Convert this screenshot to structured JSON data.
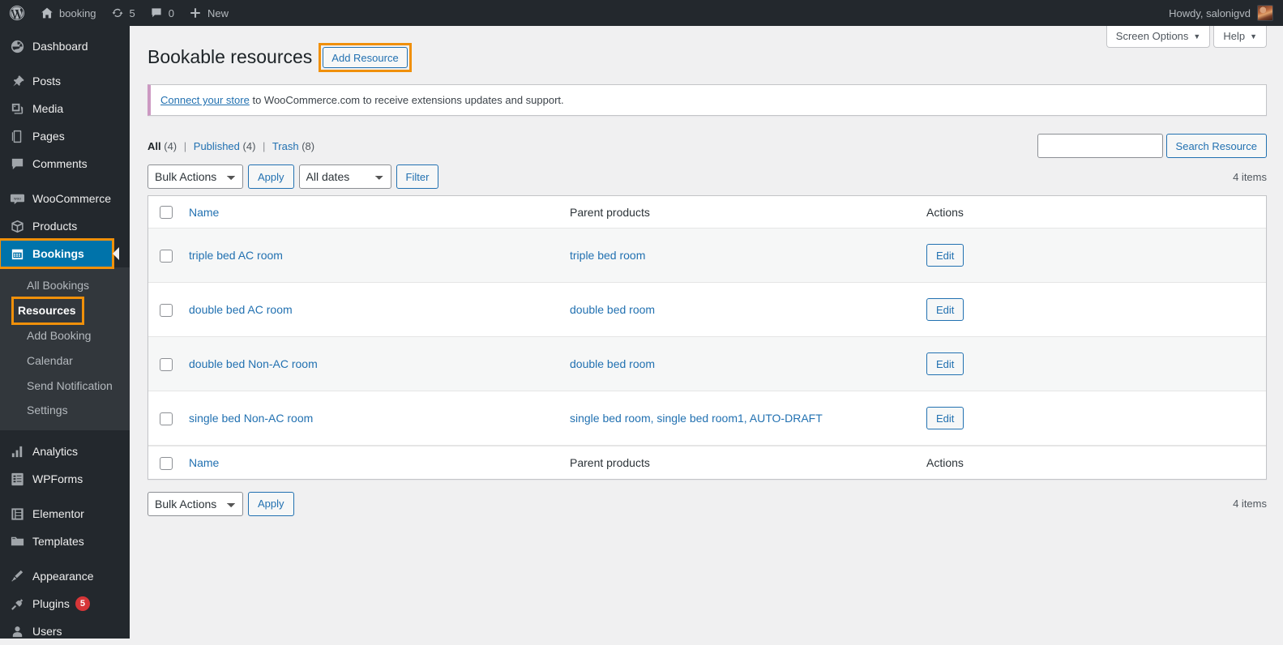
{
  "adminbar": {
    "logo_icon": "wordpress-logo-icon",
    "site_name": "booking",
    "home_icon": "home-icon",
    "updates_icon": "updates-icon",
    "updates_count": "5",
    "comments_icon": "comments-icon",
    "comments_count": "0",
    "new_icon": "plus-icon",
    "new_label": "New",
    "howdy": "Howdy, salonigvd",
    "avatar_name": "user-avatar"
  },
  "sidebar": {
    "items": [
      {
        "label": "Dashboard",
        "icon": "dashboard-icon",
        "name": "dashboard"
      },
      {
        "label": "Posts",
        "icon": "posts-pin-icon",
        "name": "posts"
      },
      {
        "label": "Media",
        "icon": "media-icon",
        "name": "media"
      },
      {
        "label": "Pages",
        "icon": "pages-icon",
        "name": "pages"
      },
      {
        "label": "Comments",
        "icon": "comments-icon",
        "name": "comments"
      },
      {
        "label": "WooCommerce",
        "icon": "woocommerce-icon",
        "name": "woocommerce"
      },
      {
        "label": "Products",
        "icon": "products-box-icon",
        "name": "products"
      },
      {
        "label": "Bookings",
        "icon": "calendar-icon",
        "name": "bookings"
      },
      {
        "label": "Analytics",
        "icon": "analytics-bars-icon",
        "name": "analytics"
      },
      {
        "label": "WPForms",
        "icon": "wpforms-icon",
        "name": "wpforms"
      },
      {
        "label": "Elementor",
        "icon": "elementor-icon",
        "name": "elementor"
      },
      {
        "label": "Templates",
        "icon": "templates-folder-icon",
        "name": "templates"
      },
      {
        "label": "Appearance",
        "icon": "appearance-brush-icon",
        "name": "appearance"
      },
      {
        "label": "Plugins",
        "icon": "plugins-plug-icon",
        "name": "plugins",
        "badge": "5"
      },
      {
        "label": "Users",
        "icon": "users-icon",
        "name": "users"
      }
    ],
    "submenu": [
      {
        "label": "All Bookings",
        "name": "all-bookings"
      },
      {
        "label": "Resources",
        "name": "resources",
        "current": true
      },
      {
        "label": "Add Booking",
        "name": "add-booking"
      },
      {
        "label": "Calendar",
        "name": "calendar"
      },
      {
        "label": "Send Notification",
        "name": "send-notification"
      },
      {
        "label": "Settings",
        "name": "settings"
      }
    ]
  },
  "screen_meta": {
    "screen_options": "Screen Options",
    "help": "Help",
    "caret": "▼"
  },
  "page": {
    "title": "Bookable resources",
    "add_button": "Add Resource"
  },
  "notice": {
    "link_text": "Connect your store",
    "rest_text": " to WooCommerce.com to receive extensions updates and support."
  },
  "views": {
    "all_label": "All",
    "all_count": "(4)",
    "published_label": "Published",
    "published_count": "(4)",
    "trash_label": "Trash",
    "trash_count": "(8)",
    "separator": "|"
  },
  "search": {
    "value": "",
    "placeholder": "",
    "button": "Search Resource"
  },
  "tablenav": {
    "bulk_actions": "Bulk Actions",
    "apply": "Apply",
    "all_dates": "All dates",
    "filter": "Filter",
    "items_top": "4 items",
    "items_bottom": "4 items"
  },
  "table": {
    "columns": [
      "Name",
      "Parent products",
      "Actions"
    ],
    "rows": [
      {
        "name": "triple bed AC room",
        "parent": "triple bed room",
        "action": "Edit"
      },
      {
        "name": "double bed AC room",
        "parent": "double bed room",
        "action": "Edit"
      },
      {
        "name": "double bed Non-AC room",
        "parent": "double bed room",
        "action": "Edit"
      },
      {
        "name": "single bed Non-AC room",
        "parent": "single bed room, single bed room1, AUTO-DRAFT",
        "action": "Edit"
      }
    ]
  },
  "colors": {
    "highlight_orange": "#f0900a",
    "admin_blue": "#0073aa",
    "link_blue": "#2271b1",
    "sidebar_dark": "#23282d",
    "submenu_dark": "#32373c",
    "notice_purple": "#cc99c2",
    "badge_red": "#d63638"
  }
}
